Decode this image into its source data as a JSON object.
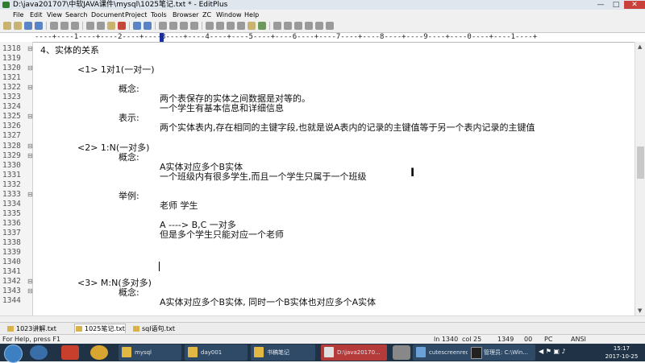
{
  "window": {
    "title": "D:\\java201707\\中软JAVA课件\\mysql\\1025笔记.txt * - EditPlus",
    "minimize": "—",
    "maximize": "□",
    "close": "✕"
  },
  "menu": [
    "File",
    "Edit",
    "View",
    "Search",
    "Document",
    "Project",
    "Tools",
    "Browser",
    "ZC",
    "Window",
    "Help"
  ],
  "ruler": "----+----1----+----2----+----3----+----4----+----5----+----6----+----7----+----8----+----9----+----0----+----1----+",
  "lines": [
    {
      "num": "1318",
      "fold": "⊟",
      "text": "4、实体的关系"
    },
    {
      "num": "1319",
      "fold": "",
      "text": ""
    },
    {
      "num": "1320",
      "fold": "⊟",
      "text": "<1> 1对1(一对一)"
    },
    {
      "num": "1321",
      "fold": "",
      "text": ""
    },
    {
      "num": "1322",
      "fold": "⊟",
      "text": "概念:"
    },
    {
      "num": "1323",
      "fold": "",
      "text": "两个表保存的实体之间数据是对等的。"
    },
    {
      "num": "1324",
      "fold": "",
      "text": "一个学生有基本信息和详细信息"
    },
    {
      "num": "1325",
      "fold": "⊟",
      "text": "表示:"
    },
    {
      "num": "1326",
      "fold": "",
      "text": "两个实体表内,存在相同的主键字段,也就是说A表内的记录的主键值等于另一个表内记录的主键值"
    },
    {
      "num": "1327",
      "fold": "",
      "text": ""
    },
    {
      "num": "1328",
      "fold": "⊟",
      "text": "<2> 1:N(一对多)"
    },
    {
      "num": "1329",
      "fold": "⊟",
      "text": "概念:"
    },
    {
      "num": "1330",
      "fold": "",
      "text": "A实体对应多个B实体"
    },
    {
      "num": "1331",
      "fold": "",
      "text": "一个班级内有很多学生,而且一个学生只属于一个班级"
    },
    {
      "num": "1332",
      "fold": "",
      "text": ""
    },
    {
      "num": "1333",
      "fold": "⊟",
      "text": "举例:"
    },
    {
      "num": "1334",
      "fold": "",
      "text": "老师          学生"
    },
    {
      "num": "1335",
      "fold": "",
      "text": ""
    },
    {
      "num": "1336",
      "fold": "",
      "text": "A       ---->  B,C     一对多"
    },
    {
      "num": "1337",
      "fold": "",
      "text": "但是多个学生只能对应一个老师"
    },
    {
      "num": "1338",
      "fold": "",
      "text": ""
    },
    {
      "num": "1339",
      "fold": "",
      "text": ""
    },
    {
      "num": "1340",
      "fold": "",
      "text": ""
    },
    {
      "num": "1341",
      "fold": "",
      "text": ""
    },
    {
      "num": "1342",
      "fold": "⊟",
      "text": "<3> M:N(多对多)"
    },
    {
      "num": "1343",
      "fold": "⊟",
      "text": "概念:"
    },
    {
      "num": "1344",
      "fold": "",
      "text": "A实体对应多个B实体, 同时一个B实体也对应多个A实体"
    }
  ],
  "tabs": [
    {
      "label": "1023讲解.txt",
      "active": false
    },
    {
      "label": "1025笔记.txt",
      "active": true
    },
    {
      "label": "sql语句.txt",
      "active": false
    }
  ],
  "status": {
    "help": "For Help, press F1",
    "line": "ln 1340",
    "col": "col 25",
    "size": "1349",
    "flag": "00",
    "format": "PC",
    "encoding": "ANSI"
  },
  "taskbar": {
    "buttons": [
      "mysql",
      "day001",
      "书稿笔记",
      "D:\\java20170...",
      "cutescreenrec...",
      "管理员: C:\\Win..."
    ],
    "time": "15:17",
    "date": "2017-10-25"
  },
  "colors": {
    "accent": "#1a2f9a",
    "taskbar": "#1f3246"
  }
}
